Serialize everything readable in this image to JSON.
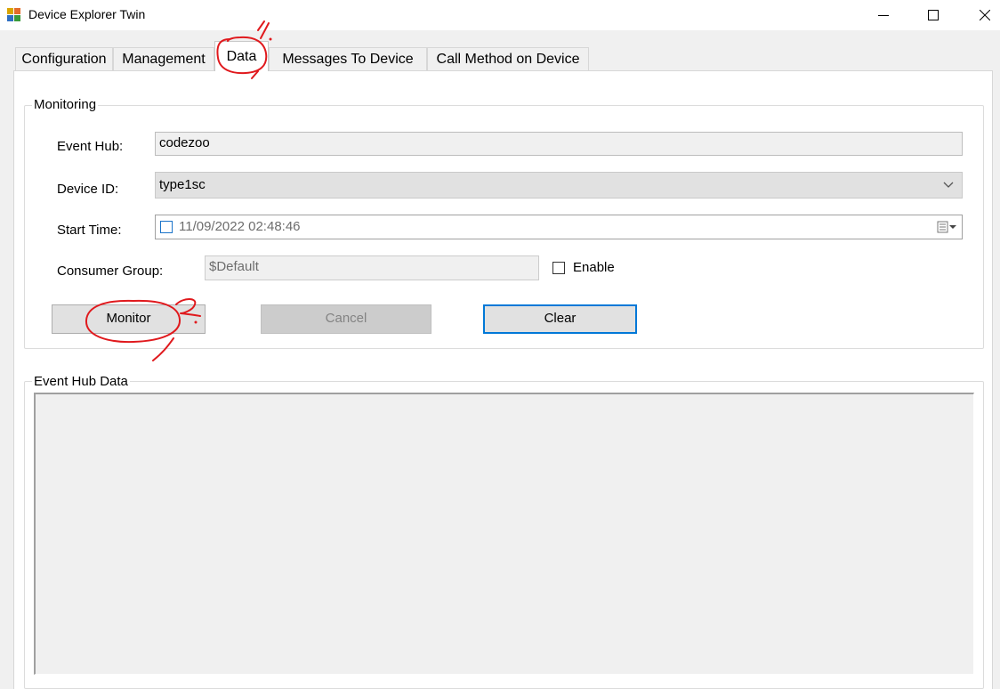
{
  "window": {
    "title": "Device Explorer Twin",
    "icons": {
      "app": "app-icon",
      "minimize": "minimize-icon",
      "maximize": "maximize-icon",
      "close": "close-icon"
    }
  },
  "tabs": [
    {
      "label": "Configuration",
      "selected": false
    },
    {
      "label": "Management",
      "selected": false
    },
    {
      "label": "Data",
      "selected": true
    },
    {
      "label": "Messages To Device",
      "selected": false
    },
    {
      "label": "Call Method on Device",
      "selected": false
    }
  ],
  "monitoring": {
    "group_title": "Monitoring",
    "event_hub": {
      "label": "Event Hub:",
      "value": "codezoo"
    },
    "device_id": {
      "label": "Device ID:",
      "value": "type1sc",
      "icon": "chevron-down-icon"
    },
    "start_time": {
      "label": "Start Time:",
      "value": "11/09/2022 02:48:46",
      "checked": false,
      "icon": "calendar-dropdown-icon"
    },
    "consumer_group": {
      "label": "Consumer Group:",
      "value": "$Default",
      "enable_label": "Enable",
      "enable_checked": false
    },
    "buttons": {
      "monitor": "Monitor",
      "cancel": "Cancel",
      "clear": "Clear"
    }
  },
  "event_hub_data": {
    "group_title": "Event Hub Data",
    "content": ""
  },
  "annotations": {
    "color": "#e0191d",
    "marks": [
      "1.",
      "2."
    ]
  },
  "colors": {
    "window_bg": "#f0f0f0",
    "panel_bg": "#ffffff",
    "focus_border": "#0078d7",
    "annotation": "#e0191d"
  }
}
